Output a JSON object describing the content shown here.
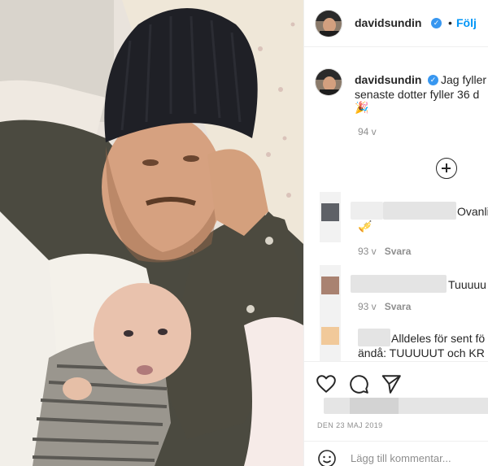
{
  "post": {
    "username": "davidsundin",
    "follow_label": "Följ",
    "dot": "•",
    "verified_mark": "✓",
    "caption_start": "Jag fyller",
    "caption_line2": "senaste dotter fyller 36 d",
    "caption_emoji": "🎉",
    "caption_time": "94 v"
  },
  "comments": [
    {
      "text": "Ovanli",
      "emoji": "🎺",
      "time": "93 v",
      "reply": "Svara",
      "avatar_color": "#5e6167"
    },
    {
      "text": "Tuuuuu",
      "time": "93 v",
      "reply": "Svara",
      "avatar_color": "#a98271"
    },
    {
      "text_line1": "Alldeles för sent fö",
      "text_line2": "ändå: TUUUUUT och KR",
      "avatar_color": "#f1c99a"
    }
  ],
  "actions": {
    "like_icon": "heart-icon",
    "comment_icon": "comment-bubble-icon",
    "share_icon": "paper-plane-icon",
    "date": "DEN 23 MAJ 2019",
    "add_comment_placeholder": "Lägg till kommentar..."
  },
  "colors": {
    "link_blue": "#0095f6",
    "verified_blue": "#3897f0",
    "muted_text": "#8e8e8e",
    "primary_text": "#262626"
  }
}
